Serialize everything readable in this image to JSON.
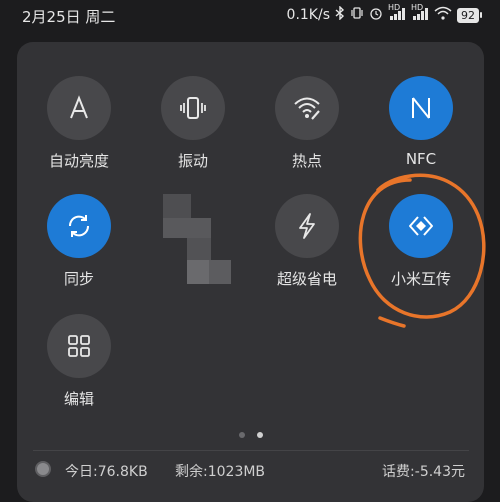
{
  "status_bar": {
    "date": "2月25日",
    "weekday": "周二",
    "net_speed": "0.1K/s",
    "signal1_label": "HD",
    "signal2_label": "HD",
    "battery": "92"
  },
  "tiles": [
    {
      "label": "自动亮度",
      "icon": "auto-brightness-icon",
      "state": "off"
    },
    {
      "label": "振动",
      "icon": "vibrate-icon",
      "state": "off"
    },
    {
      "label": "热点",
      "icon": "hotspot-icon",
      "state": "off"
    },
    {
      "label": "NFC",
      "icon": "nfc-icon",
      "state": "on"
    },
    {
      "label": "同步",
      "icon": "sync-icon",
      "state": "on"
    },
    {
      "label": "超级省电",
      "icon": "lightning-icon",
      "state": "off"
    },
    {
      "label": "小米互传",
      "icon": "mi-share-icon",
      "state": "on"
    },
    {
      "label": "编辑",
      "icon": "grid-icon",
      "state": "off"
    }
  ],
  "page_indicator": {
    "pages": 2,
    "current": 2
  },
  "footer": {
    "today": "今日:76.8KB",
    "remain": "剩余:1023MB",
    "fee": "话费:-5.43元"
  },
  "colors": {
    "panel": "#333336",
    "tile_off": "#48484b",
    "tile_on": "#1e7bd6",
    "annotation": "#e8752a"
  }
}
